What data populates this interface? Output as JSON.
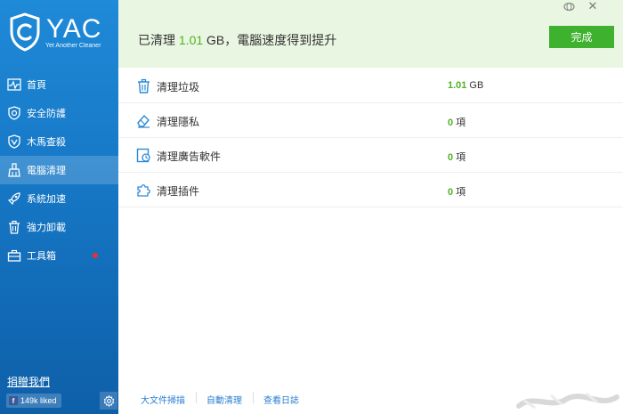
{
  "app": {
    "name": "YAC",
    "subtitle": "Yet Another Cleaner"
  },
  "colors": {
    "sidebar_blue": "#1677c5",
    "accent_green": "#52b126",
    "button_green": "#3eb12f",
    "header_bg": "#e9f6e1",
    "link_blue": "#2c7fd0",
    "badge_red": "#e8312f"
  },
  "sidebar": {
    "items": [
      {
        "label": "首頁",
        "icon": "pulse-icon"
      },
      {
        "label": "安全防護",
        "icon": "shield-icon"
      },
      {
        "label": "木馬查殺",
        "icon": "shield-v-icon"
      },
      {
        "label": "電腦清理",
        "icon": "broom-icon",
        "active": true
      },
      {
        "label": "系統加速",
        "icon": "rocket-icon"
      },
      {
        "label": "強力卸載",
        "icon": "trash-icon"
      },
      {
        "label": "工具箱",
        "icon": "toolbox-icon",
        "badge": true
      }
    ],
    "donate": "捐贈我們",
    "facebook": {
      "icon": "f",
      "likes": "149k liked"
    },
    "settings_icon": "gear-icon"
  },
  "header": {
    "prefix": "已清理",
    "amount": "1.01",
    "suffix": "GB，電腦速度得到提升",
    "done_button": "完成"
  },
  "window_controls": {
    "skin_icon": "skin-icon",
    "close_glyph": "✕"
  },
  "results": [
    {
      "label": "清理垃圾",
      "value": "1.01",
      "unit": "GB",
      "icon": "trash-icon"
    },
    {
      "label": "清理隱私",
      "value": "0",
      "unit": "項",
      "icon": "eraser-icon"
    },
    {
      "label": "清理廣告軟件",
      "value": "0",
      "unit": "項",
      "icon": "ad-clock-icon"
    },
    {
      "label": "清理插件",
      "value": "0",
      "unit": "項",
      "icon": "puzzle-icon"
    }
  ],
  "footer": {
    "links": [
      "大文件掃描",
      "自動清理",
      "查看日誌"
    ]
  }
}
